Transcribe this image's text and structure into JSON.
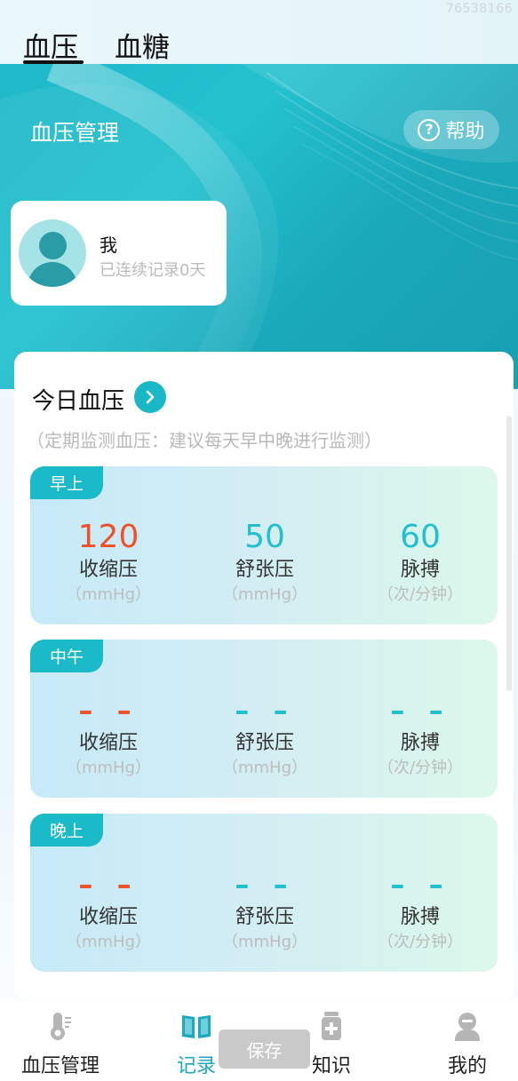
{
  "watermark": "76538166",
  "top_tabs": [
    {
      "label": "血压",
      "active": true
    },
    {
      "label": "血糖",
      "active": false
    }
  ],
  "hero": {
    "title": "血压管理",
    "help_label": "帮助",
    "help_icon_glyph": "?"
  },
  "profile": {
    "name": "我",
    "streak": "已连续记录0天"
  },
  "today": {
    "title": "今日血压",
    "hint": "（定期监测血压：建议每天早中晚进行监测）",
    "periods": [
      {
        "tag": "早上",
        "systolic": {
          "value": "120",
          "label": "收缩压",
          "unit": "（mmHg）"
        },
        "diastolic": {
          "value": "50",
          "label": "舒张压",
          "unit": "（mmHg）"
        },
        "pulse": {
          "value": "60",
          "label": "脉搏",
          "unit": "（次/分钟）"
        }
      },
      {
        "tag": "中午",
        "systolic": {
          "value": "– –",
          "label": "收缩压",
          "unit": "（mmHg）"
        },
        "diastolic": {
          "value": "– –",
          "label": "舒张压",
          "unit": "（mmHg）"
        },
        "pulse": {
          "value": "– –",
          "label": "脉搏",
          "unit": "（次/分钟）"
        }
      },
      {
        "tag": "晚上",
        "systolic": {
          "value": "– –",
          "label": "收缩压",
          "unit": "（mmHg）"
        },
        "diastolic": {
          "value": "– –",
          "label": "舒张压",
          "unit": "（mmHg）"
        },
        "pulse": {
          "value": "– –",
          "label": "脉搏",
          "unit": "（次/分钟）"
        }
      }
    ]
  },
  "bottom_nav": {
    "items": [
      {
        "label": "血压管理",
        "icon": "thermometer-icon",
        "active": false
      },
      {
        "label": "记录",
        "icon": "book-icon",
        "active": true
      },
      {
        "label": "知识",
        "icon": "medicine-icon",
        "active": false
      },
      {
        "label": "我的",
        "icon": "user-icon",
        "active": false
      }
    ],
    "save_label": "保存"
  },
  "colors": {
    "accent": "#1ab8c6",
    "systolic": "#f0502a",
    "diastolic": "#22c0cf",
    "active_nav": "#1aa9be"
  }
}
